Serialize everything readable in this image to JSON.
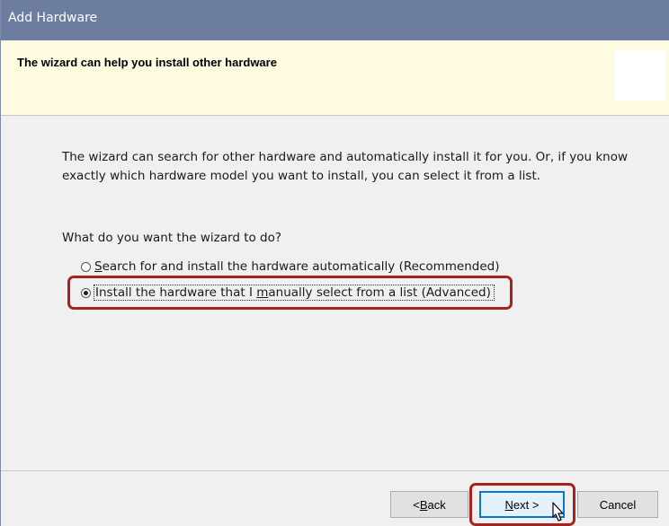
{
  "window": {
    "title": "Add Hardware"
  },
  "header": {
    "title": "The wizard can help you install other hardware"
  },
  "body": {
    "description": "The wizard can search for other hardware and automatically install it for you. Or, if you know exactly which hardware model you want to install, you can select it from a list.",
    "question": "What do you want the wizard to do?",
    "options": [
      {
        "pre": "",
        "accel": "S",
        "post": "earch for and install the hardware automatically (Recommended)",
        "selected": false
      },
      {
        "pre": "Install the hardware that I ",
        "accel": "m",
        "post": "anually select from a list (Advanced)",
        "selected": true
      }
    ]
  },
  "buttons": {
    "back_pre": "< ",
    "back_accel": "B",
    "back_post": "ack",
    "next_accel": "N",
    "next_post": "ext >",
    "cancel": "Cancel"
  },
  "colors": {
    "titlebar": "#6d7d9f",
    "header_bg": "#fefbe0",
    "highlight": "#a82020",
    "focus_border": "#0078d7"
  },
  "icons": {
    "cursor": "pointer-cursor-icon"
  }
}
